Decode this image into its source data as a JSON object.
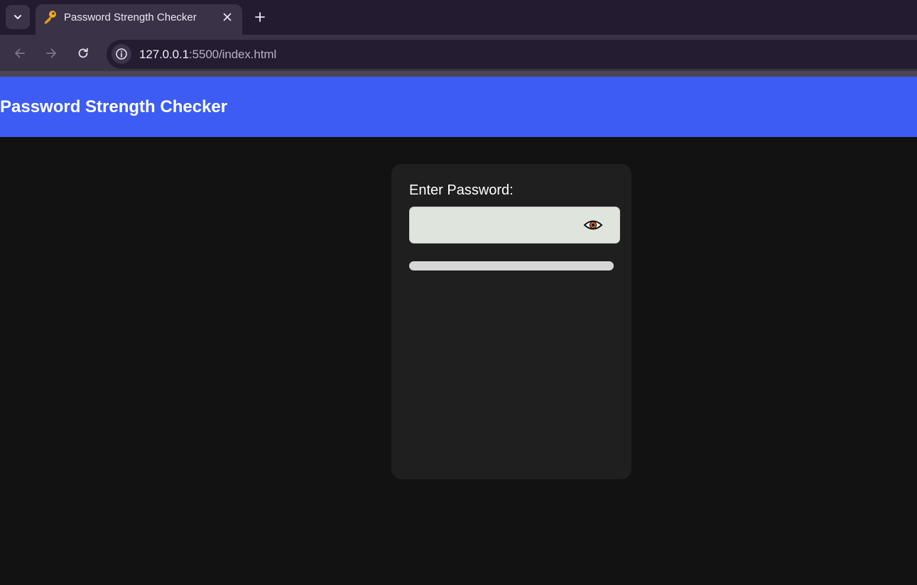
{
  "browser": {
    "tab": {
      "title": "Password Strength Checker",
      "favicon": "key-icon"
    },
    "address_bar": {
      "host": "127.0.0.1",
      "rest": ":5500/index.html"
    }
  },
  "page": {
    "header": {
      "title": "Password Strength Checker"
    },
    "form": {
      "label": "Enter Password:",
      "password_value": "",
      "toggle_icon": "eye-icon",
      "strength": 0
    }
  },
  "colors": {
    "header_bg": "#3c5cf4",
    "page_bg": "#121212",
    "card_bg": "#1f1f1f",
    "input_bg": "#dfe4dd",
    "track_bg": "#d6d6d6",
    "eye_iris": "#e0661c"
  }
}
